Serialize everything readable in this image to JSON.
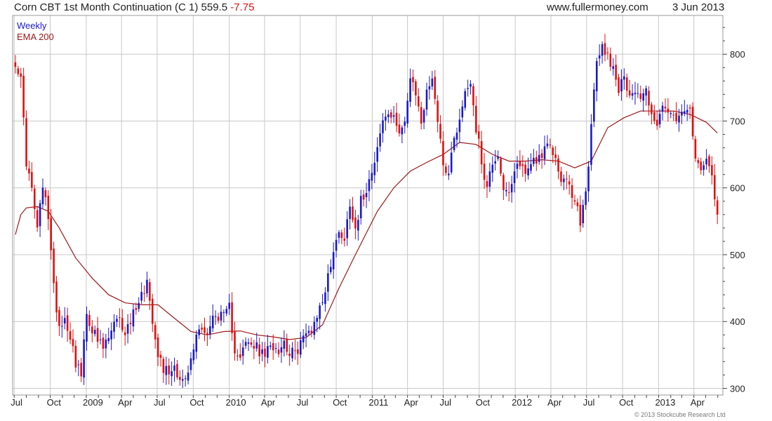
{
  "header": {
    "title": "Corn CBT 1st Month Continuation (C 1) 559.5",
    "change": "-7.75",
    "site": "www.fullermoney.com",
    "date": "3 Jun 2013"
  },
  "legend": {
    "weekly": "Weekly",
    "ema": "EMA 200"
  },
  "copyright": "© 2013 Stockcube Research Ltd",
  "colors": {
    "up": "#1a1ac8",
    "down": "#e01010",
    "ema": "#a01818",
    "grid": "#c8c8c8",
    "axis": "#222222"
  },
  "chart_data": {
    "type": "candlestick",
    "title": "Corn CBT 1st Month Continuation (C 1) 559.5 -7.75",
    "xlabel": "",
    "ylabel": "",
    "ylim": [
      290,
      858
    ],
    "y_ticks": [
      300,
      400,
      500,
      600,
      700,
      800
    ],
    "x_ticks": [
      "Jul",
      "Oct",
      "2009",
      "Apr",
      "Jul",
      "Oct",
      "2010",
      "Apr",
      "Jul",
      "Oct",
      "2011",
      "Apr",
      "Jul",
      "Oct",
      "2012",
      "Apr",
      "Jul",
      "Oct",
      "2013",
      "Apr"
    ],
    "grid": true,
    "legend_position": "top-left",
    "series": [
      {
        "name": "Weekly",
        "close_points": [
          [
            "2008-07-04",
            790
          ],
          [
            "2008-07-18",
            760
          ],
          [
            "2008-08-01",
            640
          ],
          [
            "2008-08-15",
            595
          ],
          [
            "2008-08-29",
            540
          ],
          [
            "2008-09-12",
            600
          ],
          [
            "2008-09-26",
            560
          ],
          [
            "2008-10-10",
            450
          ],
          [
            "2008-10-24",
            395
          ],
          [
            "2008-11-07",
            405
          ],
          [
            "2008-11-21",
            380
          ],
          [
            "2008-12-05",
            340
          ],
          [
            "2008-12-19",
            320
          ],
          [
            "2009-01-02",
            410
          ],
          [
            "2009-01-16",
            390
          ],
          [
            "2009-01-30",
            370
          ],
          [
            "2009-02-13",
            360
          ],
          [
            "2009-02-27",
            375
          ],
          [
            "2009-03-13",
            395
          ],
          [
            "2009-03-27",
            400
          ],
          [
            "2009-04-10",
            385
          ],
          [
            "2009-04-24",
            400
          ],
          [
            "2009-05-08",
            425
          ],
          [
            "2009-05-22",
            440
          ],
          [
            "2009-06-05",
            460
          ],
          [
            "2009-06-19",
            405
          ],
          [
            "2009-07-03",
            355
          ],
          [
            "2009-07-17",
            330
          ],
          [
            "2009-07-31",
            325
          ],
          [
            "2009-08-14",
            335
          ],
          [
            "2009-08-28",
            315
          ],
          [
            "2009-09-11",
            310
          ],
          [
            "2009-09-25",
            340
          ],
          [
            "2009-10-09",
            380
          ],
          [
            "2009-10-23",
            395
          ],
          [
            "2009-11-06",
            380
          ],
          [
            "2009-11-20",
            405
          ],
          [
            "2009-12-04",
            410
          ],
          [
            "2009-12-18",
            405
          ],
          [
            "2010-01-01",
            420
          ],
          [
            "2010-01-15",
            360
          ],
          [
            "2010-01-29",
            350
          ],
          [
            "2010-02-12",
            365
          ],
          [
            "2010-02-26",
            365
          ],
          [
            "2010-03-12",
            360
          ],
          [
            "2010-03-26",
            350
          ],
          [
            "2010-04-09",
            355
          ],
          [
            "2010-04-23",
            365
          ],
          [
            "2010-05-07",
            360
          ],
          [
            "2010-05-21",
            370
          ],
          [
            "2010-06-04",
            355
          ],
          [
            "2010-06-18",
            350
          ],
          [
            "2010-07-02",
            370
          ],
          [
            "2010-07-16",
            380
          ],
          [
            "2010-07-30",
            390
          ],
          [
            "2010-08-13",
            410
          ],
          [
            "2010-08-27",
            430
          ],
          [
            "2010-09-10",
            470
          ],
          [
            "2010-09-24",
            500
          ],
          [
            "2010-10-08",
            540
          ],
          [
            "2010-10-22",
            520
          ],
          [
            "2010-11-05",
            580
          ],
          [
            "2010-11-19",
            540
          ],
          [
            "2010-12-03",
            580
          ],
          [
            "2010-12-17",
            600
          ],
          [
            "2010-12-31",
            630
          ],
          [
            "2011-01-14",
            660
          ],
          [
            "2011-01-28",
            700
          ],
          [
            "2011-02-11",
            710
          ],
          [
            "2011-02-25",
            700
          ],
          [
            "2011-03-11",
            690
          ],
          [
            "2011-03-25",
            700
          ],
          [
            "2011-04-08",
            760
          ],
          [
            "2011-04-22",
            740
          ],
          [
            "2011-05-06",
            700
          ],
          [
            "2011-05-20",
            740
          ],
          [
            "2011-06-03",
            770
          ],
          [
            "2011-06-17",
            700
          ],
          [
            "2011-07-01",
            640
          ],
          [
            "2011-07-15",
            620
          ],
          [
            "2011-07-29",
            680
          ],
          [
            "2011-08-12",
            700
          ],
          [
            "2011-08-26",
            745
          ],
          [
            "2011-09-09",
            760
          ],
          [
            "2011-09-23",
            690
          ],
          [
            "2011-10-07",
            640
          ],
          [
            "2011-10-21",
            600
          ],
          [
            "2011-11-04",
            640
          ],
          [
            "2011-11-18",
            650
          ],
          [
            "2011-12-02",
            600
          ],
          [
            "2011-12-16",
            585
          ],
          [
            "2011-12-30",
            620
          ],
          [
            "2012-01-13",
            640
          ],
          [
            "2012-01-27",
            620
          ],
          [
            "2012-02-10",
            640
          ],
          [
            "2012-02-24",
            645
          ],
          [
            "2012-03-09",
            650
          ],
          [
            "2012-03-23",
            660
          ],
          [
            "2012-04-06",
            655
          ],
          [
            "2012-04-20",
            625
          ],
          [
            "2012-05-04",
            610
          ],
          [
            "2012-05-18",
            600
          ],
          [
            "2012-06-01",
            580
          ],
          [
            "2012-06-15",
            550
          ],
          [
            "2012-06-29",
            590
          ],
          [
            "2012-07-13",
            690
          ],
          [
            "2012-07-27",
            790
          ],
          [
            "2012-08-10",
            810
          ],
          [
            "2012-08-24",
            800
          ],
          [
            "2012-09-07",
            780
          ],
          [
            "2012-09-21",
            750
          ],
          [
            "2012-10-05",
            760
          ],
          [
            "2012-10-19",
            745
          ],
          [
            "2012-11-02",
            745
          ],
          [
            "2012-11-16",
            735
          ],
          [
            "2012-11-30",
            745
          ],
          [
            "2012-12-14",
            715
          ],
          [
            "2012-12-28",
            690
          ],
          [
            "2013-01-11",
            720
          ],
          [
            "2013-01-25",
            715
          ],
          [
            "2013-02-08",
            700
          ],
          [
            "2013-02-22",
            700
          ],
          [
            "2013-03-08",
            720
          ],
          [
            "2013-03-22",
            710
          ],
          [
            "2013-04-05",
            640
          ],
          [
            "2013-04-19",
            635
          ],
          [
            "2013-05-03",
            650
          ],
          [
            "2013-05-17",
            620
          ],
          [
            "2013-05-31",
            560
          ]
        ]
      },
      {
        "name": "EMA 200",
        "points": [
          [
            "2008-07-04",
            530
          ],
          [
            "2008-07-18",
            560
          ],
          [
            "2008-08-01",
            570
          ],
          [
            "2008-08-29",
            572
          ],
          [
            "2008-09-26",
            565
          ],
          [
            "2008-10-24",
            540
          ],
          [
            "2008-12-05",
            495
          ],
          [
            "2009-01-16",
            465
          ],
          [
            "2009-02-27",
            440
          ],
          [
            "2009-04-10",
            428
          ],
          [
            "2009-05-22",
            425
          ],
          [
            "2009-07-03",
            425
          ],
          [
            "2009-08-14",
            405
          ],
          [
            "2009-09-25",
            385
          ],
          [
            "2009-11-06",
            380
          ],
          [
            "2009-12-18",
            385
          ],
          [
            "2010-01-29",
            386
          ],
          [
            "2010-03-12",
            380
          ],
          [
            "2010-04-23",
            377
          ],
          [
            "2010-06-04",
            373
          ],
          [
            "2010-07-16",
            376
          ],
          [
            "2010-08-27",
            395
          ],
          [
            "2010-10-08",
            450
          ],
          [
            "2010-11-19",
            500
          ],
          [
            "2011-01-14",
            565
          ],
          [
            "2011-02-25",
            600
          ],
          [
            "2011-04-08",
            625
          ],
          [
            "2011-05-20",
            638
          ],
          [
            "2011-07-01",
            650
          ],
          [
            "2011-08-12",
            668
          ],
          [
            "2011-09-23",
            665
          ],
          [
            "2011-11-04",
            650
          ],
          [
            "2011-12-16",
            640
          ],
          [
            "2012-01-27",
            640
          ],
          [
            "2012-03-09",
            642
          ],
          [
            "2012-04-20",
            640
          ],
          [
            "2012-06-01",
            630
          ],
          [
            "2012-07-13",
            640
          ],
          [
            "2012-08-24",
            690
          ],
          [
            "2012-10-05",
            705
          ],
          [
            "2012-11-16",
            715
          ],
          [
            "2012-12-28",
            715
          ],
          [
            "2013-02-08",
            715
          ],
          [
            "2013-03-22",
            710
          ],
          [
            "2013-05-03",
            698
          ],
          [
            "2013-05-31",
            682
          ]
        ]
      }
    ]
  }
}
